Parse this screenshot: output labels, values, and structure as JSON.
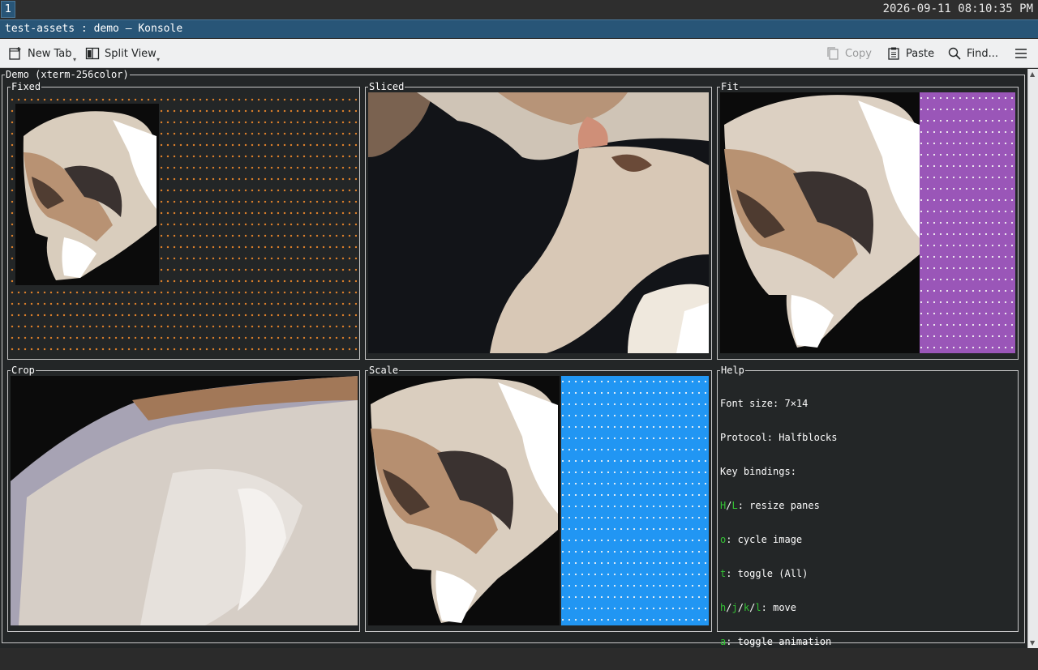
{
  "topbar": {
    "workspace": "1",
    "clock": "2026-09-11 08:10:35 PM"
  },
  "window": {
    "title": "test-assets : demo — Konsole"
  },
  "toolbar": {
    "new_tab": "New Tab",
    "split_view": "Split View",
    "copy": "Copy",
    "paste": "Paste",
    "find": "Find..."
  },
  "terminal": {
    "title": "Demo (xterm-256color)"
  },
  "panes": {
    "fixed": "Fixed",
    "sliced": "Sliced",
    "fit": "Fit",
    "crop": "Crop",
    "scale": "Scale",
    "help": "Help"
  },
  "help": {
    "font_size": "Font size: 7×14",
    "protocol": "Protocol: Halfblocks",
    "key_bindings": "Key bindings:",
    "lines": [
      {
        "keys": [
          "H",
          "L"
        ],
        "sep": "/",
        "desc": ": resize panes"
      },
      {
        "keys": [
          "o"
        ],
        "sep": "",
        "desc": ": cycle image"
      },
      {
        "keys": [
          "t"
        ],
        "sep": "",
        "desc": ": toggle (All)"
      },
      {
        "keys": [
          "h",
          "j",
          "k",
          "l"
        ],
        "sep": "/",
        "desc": ": move"
      },
      {
        "keys": [
          "a"
        ],
        "sep": "",
        "desc": ": toggle animation"
      }
    ]
  },
  "colors": {
    "accent_blue": "#285577",
    "stream_orange": "#e0822a",
    "stream_purple": "#9a56b8",
    "stream_blue": "#2196f3",
    "key_green": "#35c235"
  }
}
